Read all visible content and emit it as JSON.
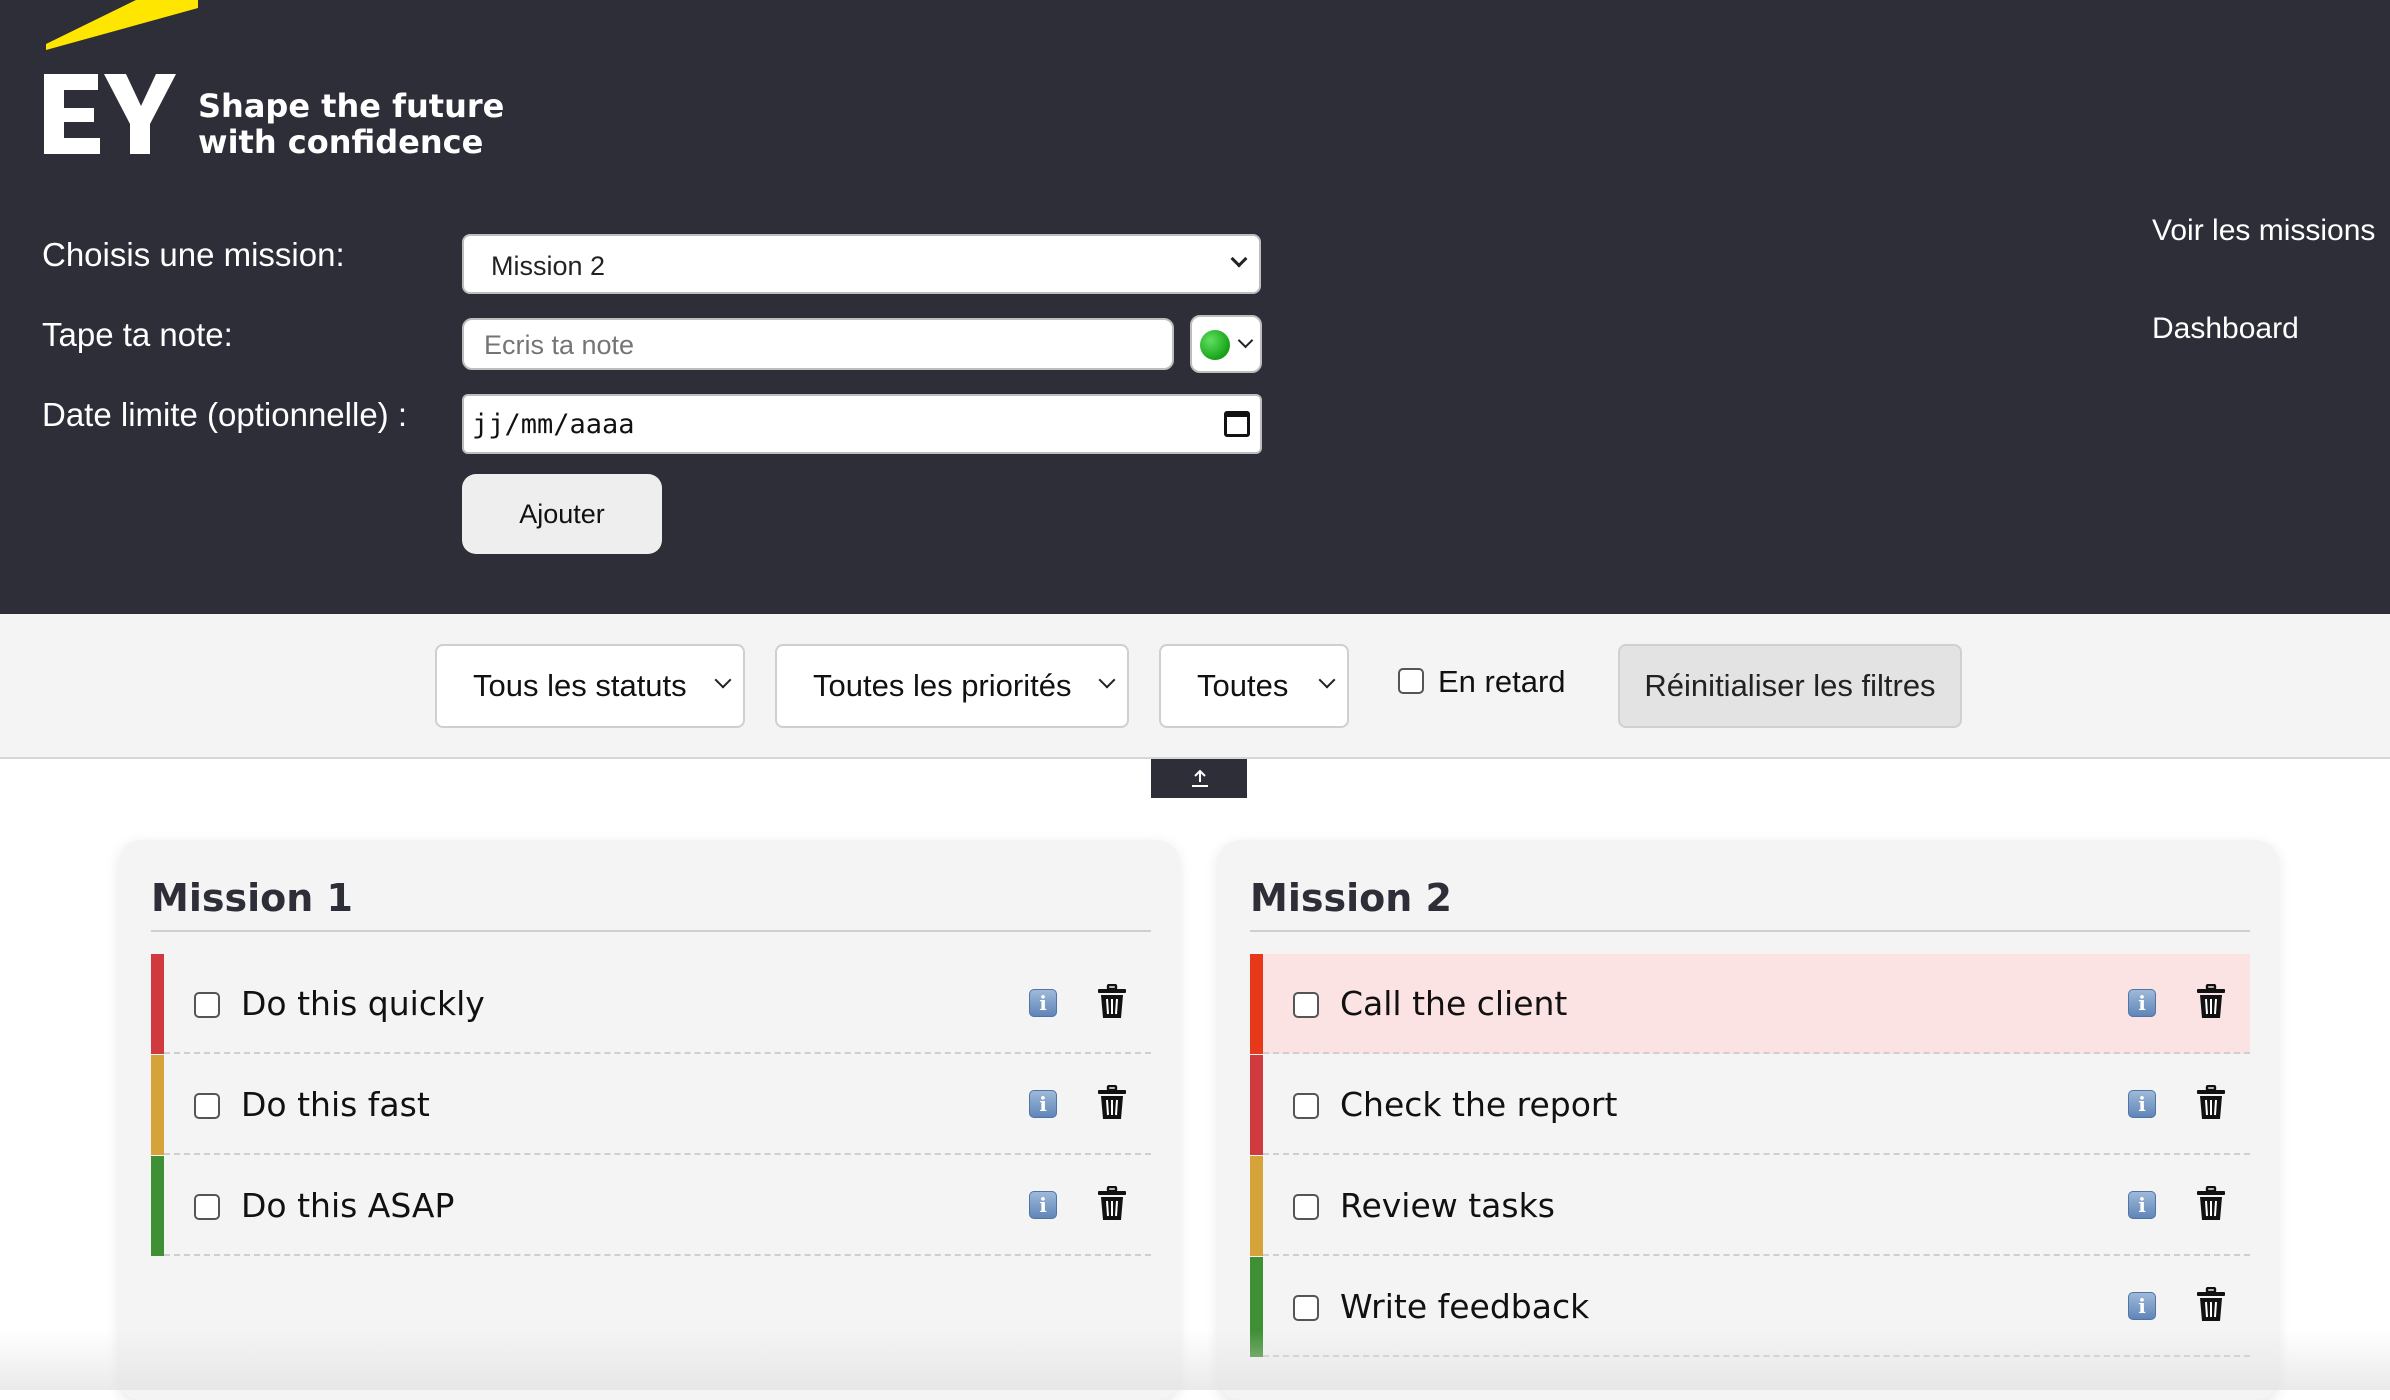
{
  "brand": {
    "logo_text": "EY",
    "tagline_line1": "Shape the future",
    "tagline_line2": "with confidence",
    "accent_color": "#ffe600",
    "header_bg": "#2e2e38"
  },
  "form": {
    "mission_label": "Choisis une mission:",
    "mission_selected": "Mission 2",
    "note_label": "Tape ta note:",
    "note_placeholder": "Ecris ta note",
    "priority_color_selected": "green",
    "date_label": "Date limite (optionnelle) :",
    "date_placeholder": "jj/mm/aaaa",
    "add_button": "Ajouter"
  },
  "nav": {
    "missions_link": "Voir les missions",
    "dashboard_link": "Dashboard"
  },
  "filters": {
    "status_selected": "Tous les statuts",
    "priority_selected": "Toutes les priorités",
    "due_selected": "Toutes",
    "late_label": "En retard",
    "late_checked": false,
    "reset_button": "Réinitialiser les filtres"
  },
  "icons": {
    "scroll_top": "upload-arrow-icon",
    "info": "info-icon",
    "delete": "trash-icon",
    "calendar": "calendar-icon",
    "dropdown": "chevron-down-icon"
  },
  "priority_colors": {
    "high": "#d03a3e",
    "medium": "#d4a43a",
    "low": "#3f8f35",
    "urgent": "#e8381a"
  },
  "missions": [
    {
      "title": "Mission 1",
      "tasks": [
        {
          "label": "Do this quickly",
          "priority": "high",
          "checked": false,
          "highlight": false
        },
        {
          "label": "Do this fast",
          "priority": "medium",
          "checked": false,
          "highlight": false
        },
        {
          "label": "Do this ASAP",
          "priority": "low",
          "checked": false,
          "highlight": false
        }
      ]
    },
    {
      "title": "Mission 2",
      "tasks": [
        {
          "label": "Call the client",
          "priority": "urgent",
          "checked": false,
          "highlight": true
        },
        {
          "label": "Check the report",
          "priority": "high",
          "checked": false,
          "highlight": false
        },
        {
          "label": "Review tasks",
          "priority": "medium",
          "checked": false,
          "highlight": false
        },
        {
          "label": "Write feedback",
          "priority": "low",
          "checked": false,
          "highlight": false
        }
      ]
    }
  ]
}
